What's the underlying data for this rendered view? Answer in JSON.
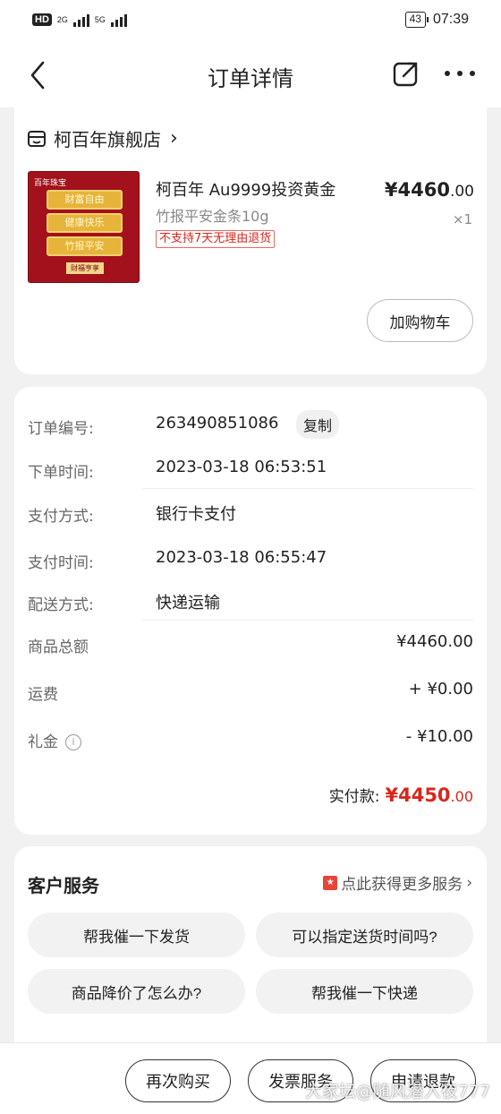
{
  "status_bar": {
    "hd": "HD",
    "hd_sub": "2",
    "net1": "2G",
    "net2": "5G",
    "battery": "43",
    "time": "07:39"
  },
  "nav": {
    "title": "订单详情"
  },
  "shop": {
    "name": "柯百年旗舰店",
    "chevron": "›"
  },
  "product": {
    "thumb_brand": "百年珠宝",
    "thumb_bar1": "财富自由",
    "thumb_bar2": "健康快乐",
    "thumb_bar3": "竹报平安",
    "thumb_tag": "财福亨享",
    "title": "柯百年 Au9999投资黄金",
    "subtitle": "竹报平安金条10g",
    "policy_tag": "不支持7天无理由退货",
    "price_main": "¥4460",
    "price_dec": ".00",
    "quantity": "×1",
    "add_cart": "加购物车"
  },
  "order_info": {
    "order_no_label": "订单编号:",
    "order_no": "263490851086",
    "copy": "复制",
    "order_time_label": "下单时间:",
    "order_time": "2023-03-18 06:53:51",
    "pay_method_label": "支付方式:",
    "pay_method": "银行卡支付",
    "pay_time_label": "支付时间:",
    "pay_time": "2023-03-18 06:55:47",
    "delivery_label": "配送方式:",
    "delivery": "快递运输"
  },
  "amounts": {
    "goods_total_label": "商品总额",
    "goods_total": "¥4460.00",
    "shipping_label": "运费",
    "shipping": "+ ¥0.00",
    "gift_label": "礼金",
    "gift_info": "i",
    "gift": "- ¥10.00",
    "paid_label": "实付款:",
    "paid_main": "¥4450",
    "paid_dec": ".00"
  },
  "service": {
    "title": "客户服务",
    "more_link": "点此获得更多服务",
    "more_icon": "★",
    "more_chevron": "›",
    "btn1": "帮我催一下发货",
    "btn2": "可以指定送货时间吗?",
    "btn3": "商品降价了怎么办?",
    "btn4": "帮我催一下快递"
  },
  "bottom": {
    "rebuy": "再次购买",
    "invoice": "发票服务",
    "refund": "申请退款"
  },
  "watermark": "大家坛@随风潜入夜777",
  "colors": {
    "accent_red": "#d9261c",
    "background": "#f1f1f1"
  }
}
